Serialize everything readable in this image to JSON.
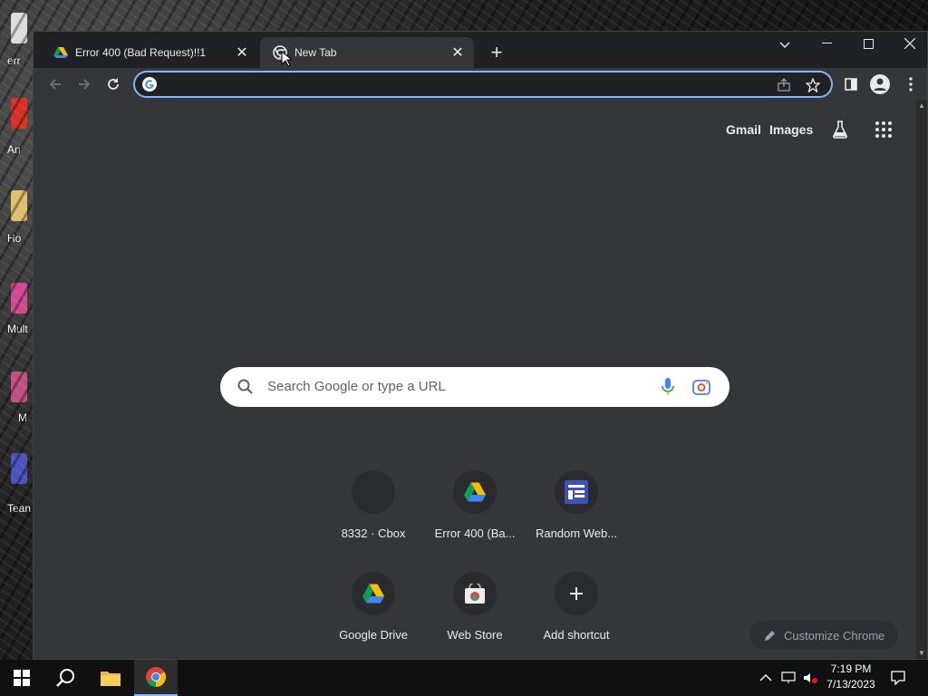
{
  "desktop": {
    "icons": [
      {
        "label": "err",
        "color": "#dddddd"
      },
      {
        "label": "An",
        "color": "#d93025"
      },
      {
        "label": "Ho",
        "color": "#e0c070"
      },
      {
        "label": "Mult",
        "color": "#d04a90"
      },
      {
        "label": "M",
        "color": "#c05080"
      },
      {
        "label": "Tean",
        "color": "#4b53bc"
      }
    ]
  },
  "browser": {
    "tabs": [
      {
        "title": "Error 400 (Bad Request)!!1",
        "icon": "google-drive-icon",
        "active": false
      },
      {
        "title": "New Tab",
        "icon": "chrome-icon",
        "active": true
      }
    ],
    "omnibox": {
      "value": "",
      "placeholder": ""
    },
    "top_links": {
      "gmail": "Gmail",
      "images": "Images"
    },
    "search": {
      "placeholder": "Search Google or type a URL"
    },
    "shortcuts": [
      {
        "label": "8332 · Cbox",
        "icon": "blank-icon"
      },
      {
        "label": "Error 400 (Ba...",
        "icon": "google-drive-icon"
      },
      {
        "label": "Random Web...",
        "icon": "webpage-icon"
      },
      {
        "label": "Google Drive",
        "icon": "google-drive-icon"
      },
      {
        "label": "Web Store",
        "icon": "web-store-icon"
      },
      {
        "label": "Add shortcut",
        "icon": "plus-icon"
      }
    ],
    "customize": "Customize Chrome"
  },
  "taskbar": {
    "time": "7:19 PM",
    "date": "7/13/2023"
  },
  "colors": {
    "accent": "#8ab4f8",
    "chrome_bg": "#35363a",
    "titlebar_bg": "#202124"
  }
}
